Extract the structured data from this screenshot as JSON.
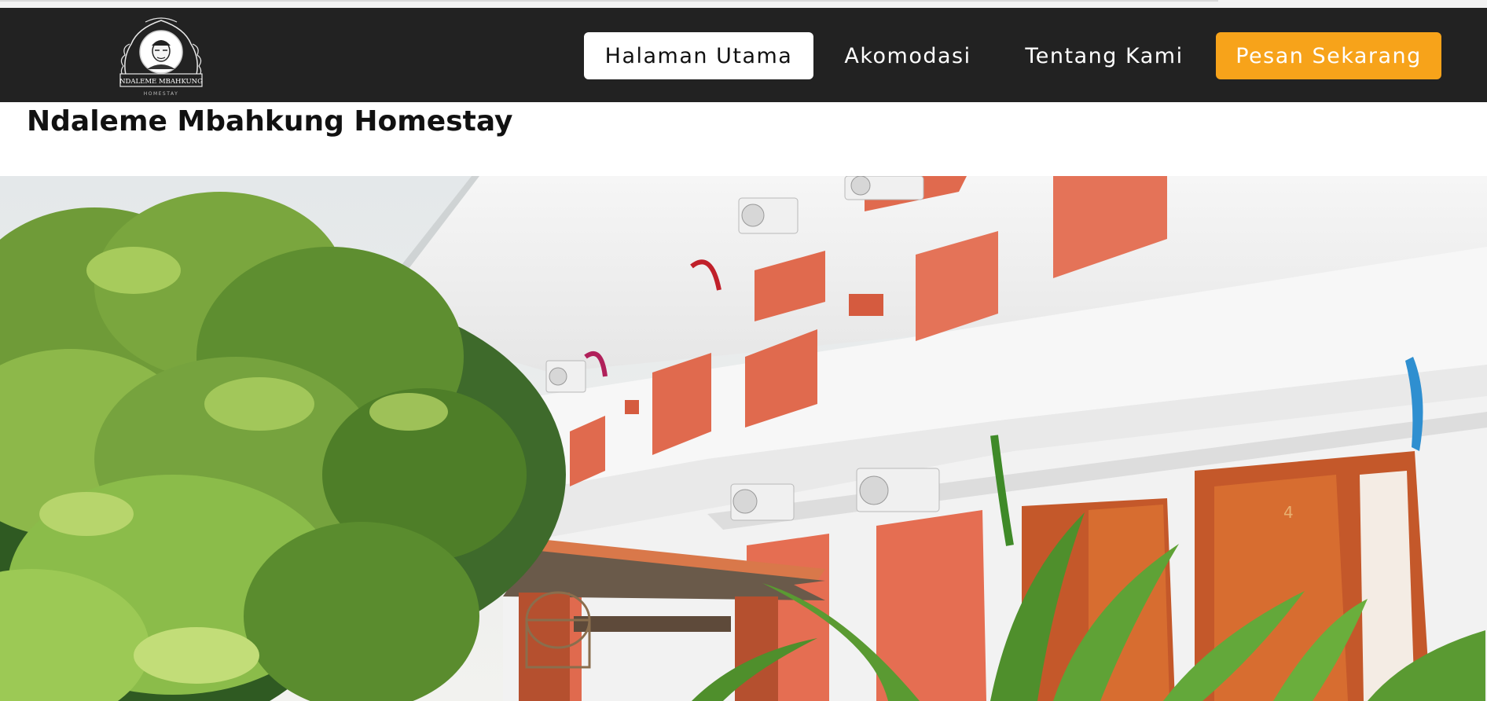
{
  "nav": {
    "logo_text": "NDALEME MBAHKUNG",
    "logo_subtext": "HOMESTAY",
    "items": [
      {
        "label": "Halaman Utama",
        "active": true
      },
      {
        "label": "Akomodasi",
        "active": false
      },
      {
        "label": "Tentang Kami",
        "active": false
      }
    ],
    "cta_label": "Pesan Sekarang",
    "colors": {
      "navbar_bg": "#222222",
      "cta_bg": "#f7a31a",
      "active_bg": "#ffffff"
    }
  },
  "page": {
    "title": "Ndaleme Mbahkung Homestay"
  },
  "hero": {
    "icon": "homestay-building-photo",
    "door_number": "4"
  }
}
